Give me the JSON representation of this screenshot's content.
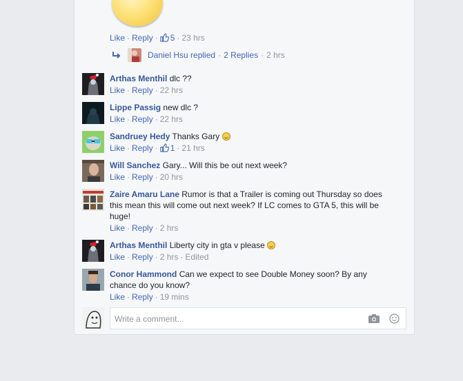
{
  "top_comment": {
    "actions": {
      "like": "Like",
      "reply": "Reply",
      "like_count": "5",
      "time": "23 hrs"
    },
    "replies": {
      "name": "Daniel Hsu",
      "replied_text": "replied",
      "count_text": "2 Replies",
      "time": "2 hrs"
    }
  },
  "comments": [
    {
      "author": "Arthas Menthil",
      "text": "dlc ??",
      "like": "Like",
      "reply": "Reply",
      "time": "22 hrs"
    },
    {
      "author": "Lippe Passig",
      "text": "new dlc ?",
      "like": "Like",
      "reply": "Reply",
      "time": "22 hrs"
    },
    {
      "author": "Sandruey Hedy",
      "text": "Thanks Gary",
      "like": "Like",
      "reply": "Reply",
      "like_count": "1",
      "time": "21 hrs"
    },
    {
      "author": "Will Sanchez",
      "text": "Gary... Will this be out next week?",
      "like": "Like",
      "reply": "Reply",
      "time": "20 hrs"
    },
    {
      "author": "Zaire Amaru Lane",
      "text": "Rumor is that a Trailer is coming out Thursday so does this mean this will come out next week? If LC comes to GTA 5, this will be huge!",
      "like": "Like",
      "reply": "Reply",
      "time": "2 hrs"
    },
    {
      "author": "Arthas Menthil",
      "text": "Liberty city in gta v please",
      "like": "Like",
      "reply": "Reply",
      "time": "2 hrs",
      "edited": "Edited"
    },
    {
      "author": "Conor Hammond",
      "text": "Can we expect to see Double Money soon? By any chance do you know?",
      "like": "Like",
      "reply": "Reply",
      "time": "19 mins"
    }
  ],
  "composer": {
    "placeholder": "Write a comment..."
  },
  "colors": {
    "link": "#4267b2",
    "author": "#365899",
    "meta": "#90949c",
    "background": "#e9ebee",
    "panel": "#f6f7f9"
  },
  "icons": [
    "wink-emoji",
    "thumbs-up-icon",
    "reply-arrow-icon",
    "smile-emoji",
    "camera-icon",
    "emoji-icon"
  ]
}
